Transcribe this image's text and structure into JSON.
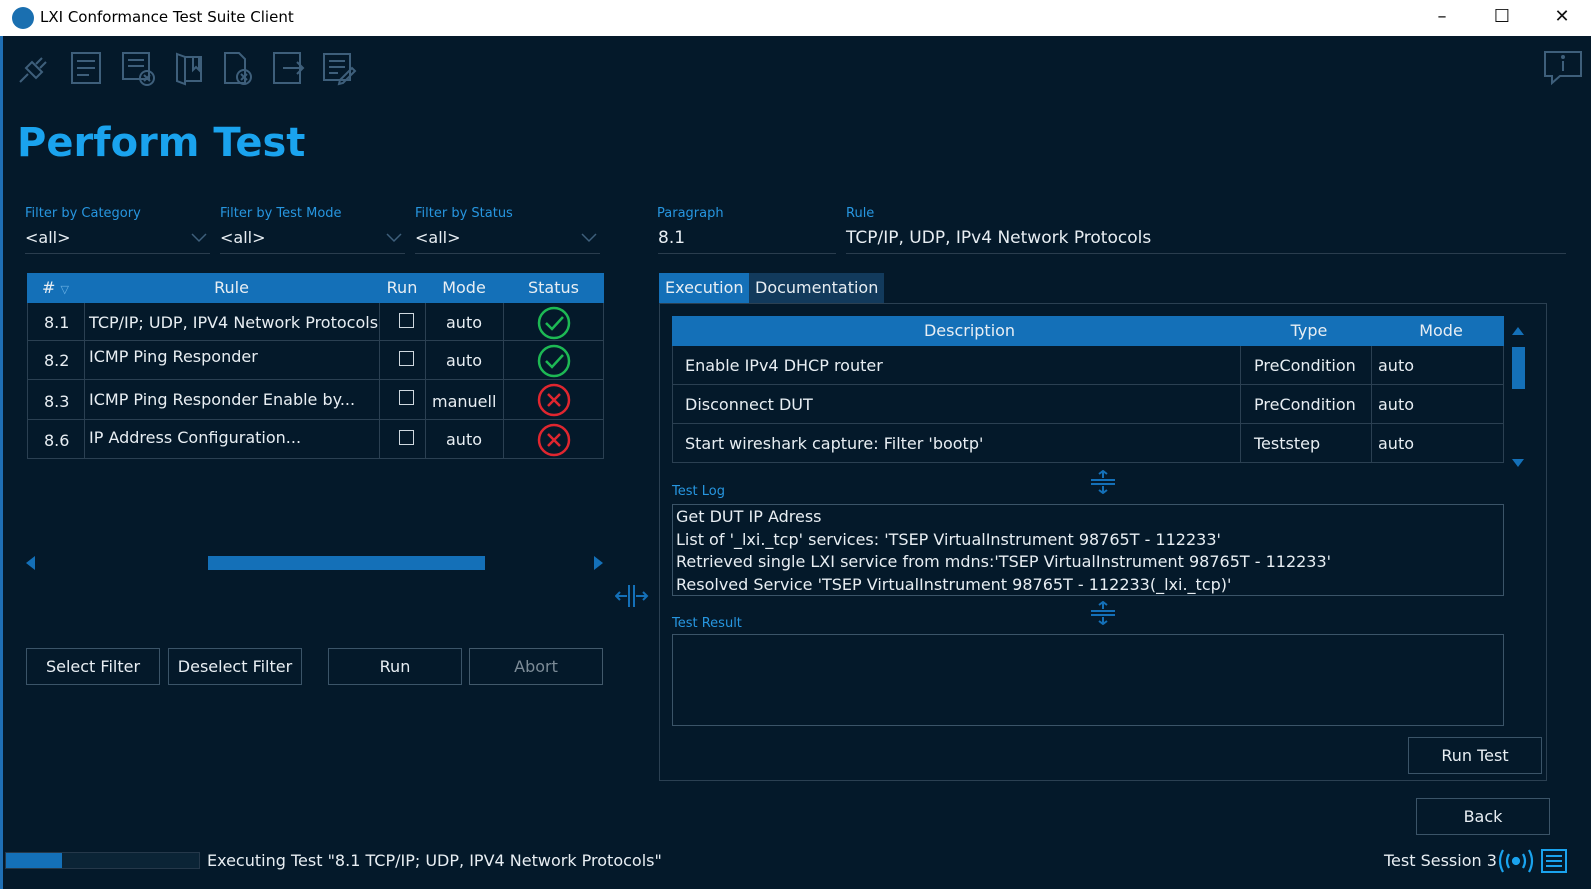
{
  "window": {
    "title": "LXI Conformance Test Suite Client",
    "min": "–",
    "max": "☐",
    "close": "✕"
  },
  "toolbar": {
    "icons": [
      "plug-icon",
      "document-icon",
      "document-remove-icon",
      "book-icon",
      "delete-file-icon",
      "export-icon",
      "edit-document-icon"
    ],
    "info_icon": "info-icon"
  },
  "page_title": "Perform Test",
  "filters": {
    "category": {
      "label": "Filter by Category",
      "value": "<all>"
    },
    "test_mode": {
      "label": "Filter by Test Mode",
      "value": "<all>"
    },
    "status": {
      "label": "Filter by Status",
      "value": "<all>"
    }
  },
  "detail": {
    "paragraph_label": "Paragraph",
    "paragraph_value": "8.1",
    "rule_label": "Rule",
    "rule_value": "TCP/IP, UDP, IPv4 Network Protocols"
  },
  "rules_table": {
    "headers": {
      "num": "#",
      "rule": "Rule",
      "run": "Run",
      "mode": "Mode",
      "status": "Status"
    },
    "rows": [
      {
        "num": "8.1",
        "rule": "TCP/IP; UDP, IPV4 Network Protocols",
        "run": false,
        "mode": "auto",
        "status": "passed"
      },
      {
        "num": "8.2",
        "rule": "ICMP Ping Responder",
        "run": false,
        "mode": "auto",
        "status": "passed"
      },
      {
        "num": "8.3",
        "rule": "ICMP Ping Responder Enable by...",
        "run": false,
        "mode": "manuell",
        "status": "failed"
      },
      {
        "num": "8.6",
        "rule": "IP Address Configuration...",
        "run": false,
        "mode": "auto",
        "status": "failed"
      }
    ]
  },
  "buttons": {
    "select_filter": "Select Filter",
    "deselect_filter": "Deselect Filter",
    "run": "Run",
    "abort": "Abort",
    "run_test": "Run Test",
    "back": "Back"
  },
  "tabs": [
    {
      "label": "Execution",
      "active": true
    },
    {
      "label": "Documentation",
      "active": false
    }
  ],
  "steps_table": {
    "headers": {
      "description": "Description",
      "type": "Type",
      "mode": "Mode"
    },
    "rows": [
      {
        "description": "Enable IPv4 DHCP router",
        "type": "PreCondition",
        "mode": "auto"
      },
      {
        "description": "Disconnect DUT",
        "type": "PreCondition",
        "mode": "auto"
      },
      {
        "description": "Start wireshark capture: Filter 'bootp'",
        "type": "Teststep",
        "mode": "auto"
      }
    ]
  },
  "test_log": {
    "label": "Test Log",
    "lines": [
      "Get DUT IP Adress",
      "List of '_lxi._tcp' services: 'TSEP VirtualInstrument 98765T - 112233'",
      "Retrieved single LXI service from mdns:'TSEP VirtualInstrument 98765T - 112233'",
      "Resolved Service 'TSEP VirtualInstrument 98765T - 112233(_lxi._tcp)'"
    ]
  },
  "test_result": {
    "label": "Test Result",
    "value": ""
  },
  "status_bar": {
    "progress": 0.29,
    "text": "Executing Test \"8.1 TCP/IP; UDP, IPV4 Network Protocols\"",
    "session": "Test Session 3"
  },
  "colors": {
    "background": "#04192a",
    "accent": "#1470b8",
    "title": "#1aa3ee",
    "pass": "#1db954",
    "fail": "#e0262f"
  }
}
